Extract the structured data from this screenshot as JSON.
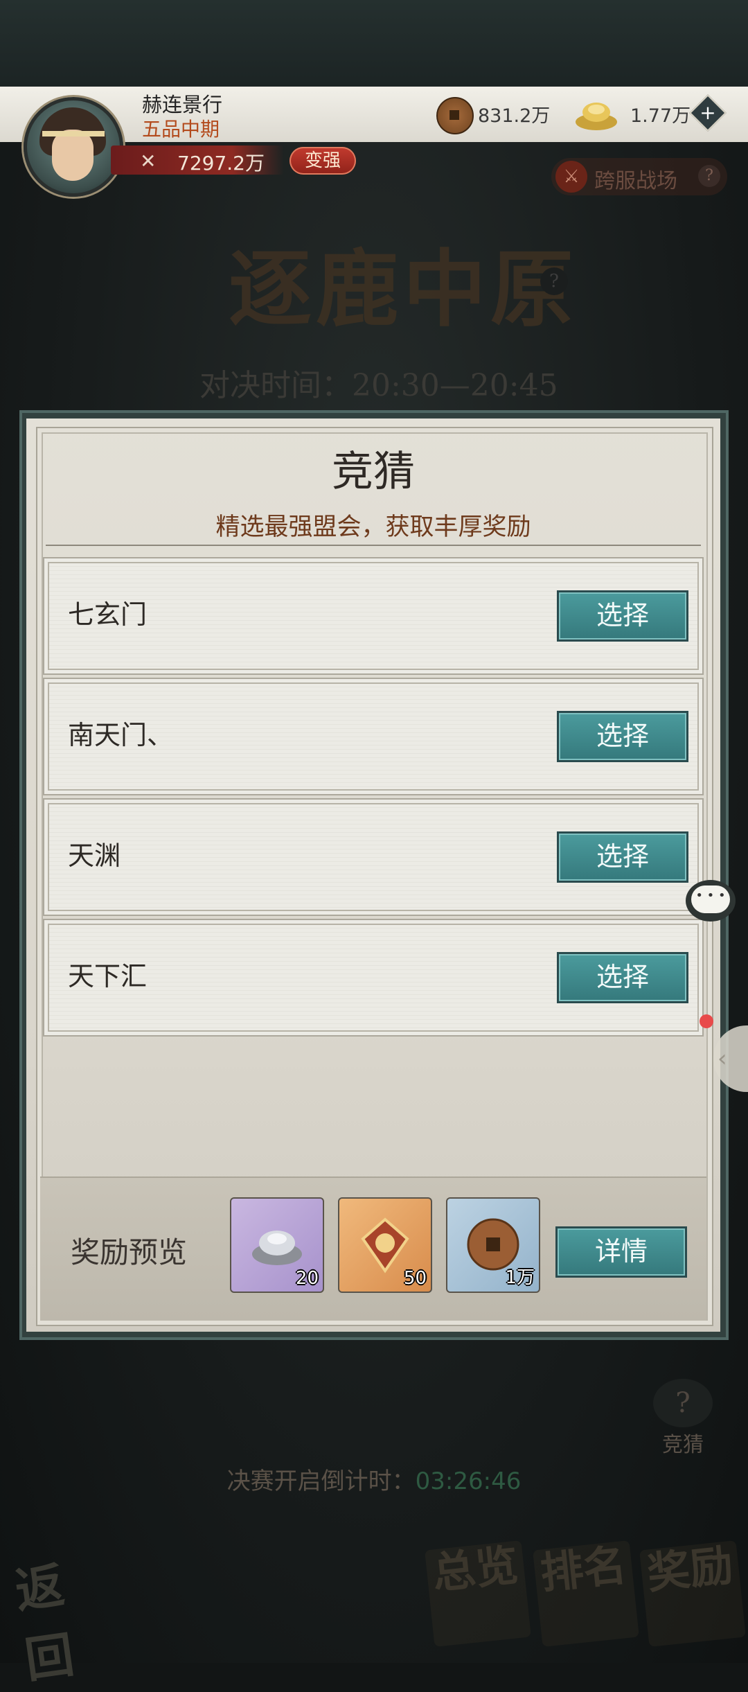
{
  "player": {
    "name": "赫连景行",
    "rank": "五品中期",
    "power": "7297.2万",
    "strengthen_label": "变强"
  },
  "currency": {
    "coin_value": "831.2万",
    "ingot_value": "1.77万",
    "add_symbol": "+"
  },
  "cross_server": {
    "label": "跨服战场",
    "help": "?"
  },
  "event": {
    "title": "逐鹿中原",
    "help": "?",
    "duel_time": "对决时间：20:30—20:45"
  },
  "guess_panel": {
    "title": "竞猜",
    "subtitle": "精选最强盟会，获取丰厚奖励",
    "options": [
      {
        "name": "七玄门",
        "button": "选择"
      },
      {
        "name": "南天门、",
        "button": "选择"
      },
      {
        "name": "天渊",
        "button": "选择"
      },
      {
        "name": "天下汇",
        "button": "选择"
      }
    ],
    "reward": {
      "label": "奖励预览",
      "items": [
        {
          "icon": "silver-ingot-icon",
          "count": "20",
          "color": "#b9a6d8"
        },
        {
          "icon": "token-icon",
          "count": "50",
          "color": "#e6a865"
        },
        {
          "icon": "copper-coin-icon",
          "count": "1万",
          "color": "#a9c3d8"
        }
      ],
      "detail_button": "详情"
    }
  },
  "side": {
    "guess_label": "竞猜"
  },
  "countdown": {
    "label": "决赛开启倒计时：",
    "value": "03:26:46"
  },
  "bottom_nav": {
    "back": "返回",
    "overview": "总览",
    "ranking": "排名",
    "rewards": "奖励"
  },
  "colors": {
    "accent_teal": "#3f8b8d",
    "panel_bg": "#e1ded5",
    "red": "#b8342a"
  }
}
